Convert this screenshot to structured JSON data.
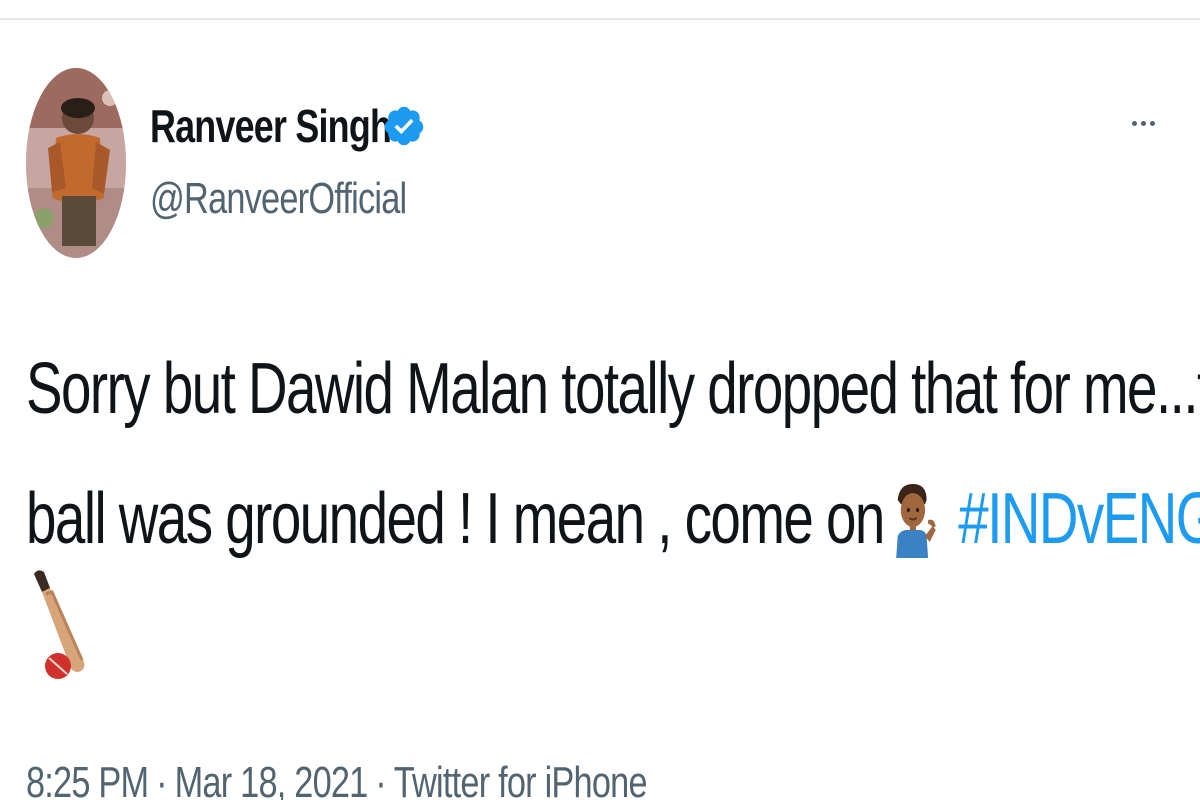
{
  "tweet": {
    "author": {
      "display_name": "Ranveer Singh",
      "handle": "@RanveerOfficial",
      "verified": true,
      "verified_icon": "verified-badge-icon",
      "avatar_icon": "profile-photo"
    },
    "more_icon": "more-horizontal-icon",
    "text": {
      "line1": "Sorry but Dawid Malan totally dropped that for me...the",
      "line2": "ball was grounded ! I mean , come on",
      "emoji_1": "man-tipping-hand-emoji",
      "hashtag": "#INDvENG",
      "emoji_2": "cricket-game-emoji"
    },
    "meta": {
      "time": "8:25 PM",
      "separator": "·",
      "date": "Mar 18, 2021",
      "source": "Twitter for iPhone"
    }
  },
  "colors": {
    "text_primary": "#0f1419",
    "text_secondary": "#536471",
    "link_blue": "#1d9bf0",
    "verified_blue": "#1d9bf0",
    "divider": "#e6e6e6"
  }
}
